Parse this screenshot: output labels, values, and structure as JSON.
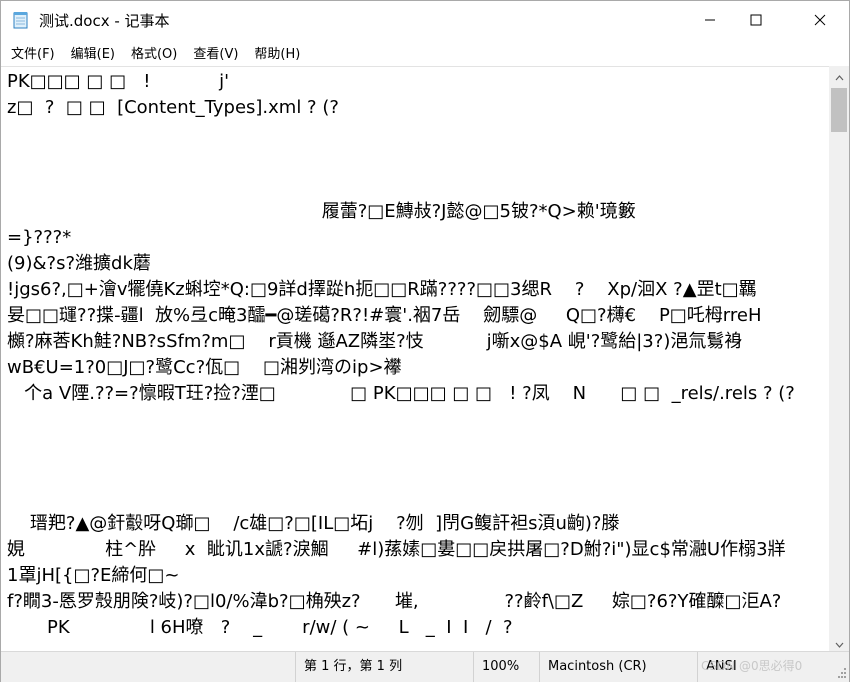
{
  "window": {
    "title": "测试.docx - 记事本"
  },
  "menubar": {
    "items": [
      "文件(F)",
      "编辑(E)",
      "格式(O)",
      "查看(V)",
      "帮助(H)"
    ]
  },
  "editor": {
    "lines": [
      "PK□□□ □ □   !            j'",
      "z□  ?  □ □  [Content_Types].xml ? (?",
      "",
      "",
      "",
      "                                                       履蕾?□E鱄敊?J懿@□5铍?*Q>赖'璄籔",
      "=}???*",
      "(9)&?s?潍擴dk蘑",
      "!jgs6?,□+澮v犤僥Kz蝌埪*Q:□9詳d擇踨h扼□□R蹣????□□3缌R    ?    Xp/洄X ?▲罡t□羈",
      "妟□□璭??揲-疆l  放%弖c晻3醽━@瑳礍?R?!#寰'.裀7岳    劒驃@     Q□?欂€    P□吒栂rreH",
      "櫇?麻莕Kh鮭?NB?sSfm?m□    r貢機 邎AZ隣埊?忮           j噺x@$A 峴'?鹭紿|3?)浥氚鬄裑",
      "wB€U=1?0□J□?鹭Cc?佤□    □湘刿湾のip>襻",
      "   个a V陻.??=?懔暇T玨?捡?湮□             □ PK□□□ □ □   ! ?凤    N      □ □  _rels/.rels ? (?",
      "",
      "",
      "",
      "",
      "    瑨羓?▲@釬鷇呀Q瑡□    /c雄□?□[IL□坧j    ?刎  ]閅G鳆訐袒s湏u齣)?滕",
      "娊              柱^肸     x  眦讥1x謕?淚鯝     #l)蓀嫊□婁□□戻拱屠□?D鮒?i\")显c$常瀜U作榒3牂",
      "1罩jH[{□?E締何□~",
      "f?瞯3-悘罗殼朋険?岐)?□l0/%湋b?□桷殃z?      墔,               ??鹷f\\□Z     婃□?6?Y確醾□洰A?",
      "       PK              l 6H嘹   ?    _       r/w/ ( ~     L   _  I  I   /  ?"
    ]
  },
  "statusbar": {
    "position": "第 1 行，第 1 列",
    "zoom": "100%",
    "line_ending": "Macintosh (CR)",
    "encoding": "ANSI"
  },
  "watermark": "CSDN @0思必得0",
  "icons": {
    "app": "notepad-icon",
    "minimize": "minimize-icon",
    "maximize": "maximize-icon",
    "close": "close-icon"
  }
}
